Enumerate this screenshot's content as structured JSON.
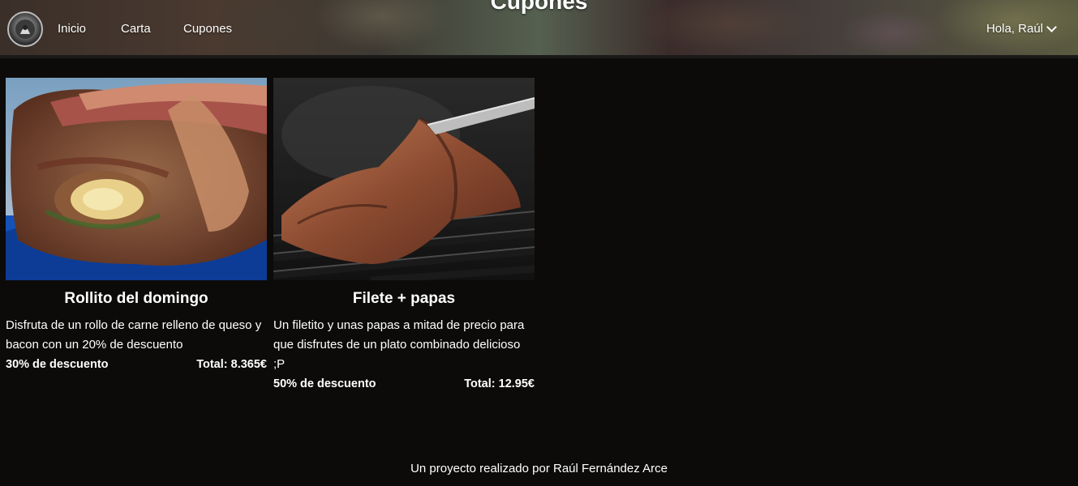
{
  "header": {
    "page_title": "Cupones",
    "nav": [
      {
        "label": "Inicio"
      },
      {
        "label": "Carta"
      },
      {
        "label": "Cupones"
      }
    ],
    "user_greeting": "Hola, Raúl"
  },
  "coupons": [
    {
      "title": "Rollito del domingo",
      "description": "Disfruta de un rollo de carne relleno de queso y bacon con un 20% de descuento",
      "discount": "30% de descuento",
      "total": "Total: 8.365€"
    },
    {
      "title": "Filete + papas",
      "description": "Un filetito y unas papas a mitad de precio para que disfrutes de un plato combinado delicioso ;P",
      "discount": "50% de descuento",
      "total": "Total: 12.95€"
    }
  ],
  "footer": {
    "text": "Un proyecto realizado por Raúl Fernández Arce"
  },
  "icons": {
    "logo": "restaurant-logo-icon",
    "dropdown": "chevron-down-icon"
  },
  "colors": {
    "background": "#0c0b09",
    "text": "#ffffff"
  }
}
